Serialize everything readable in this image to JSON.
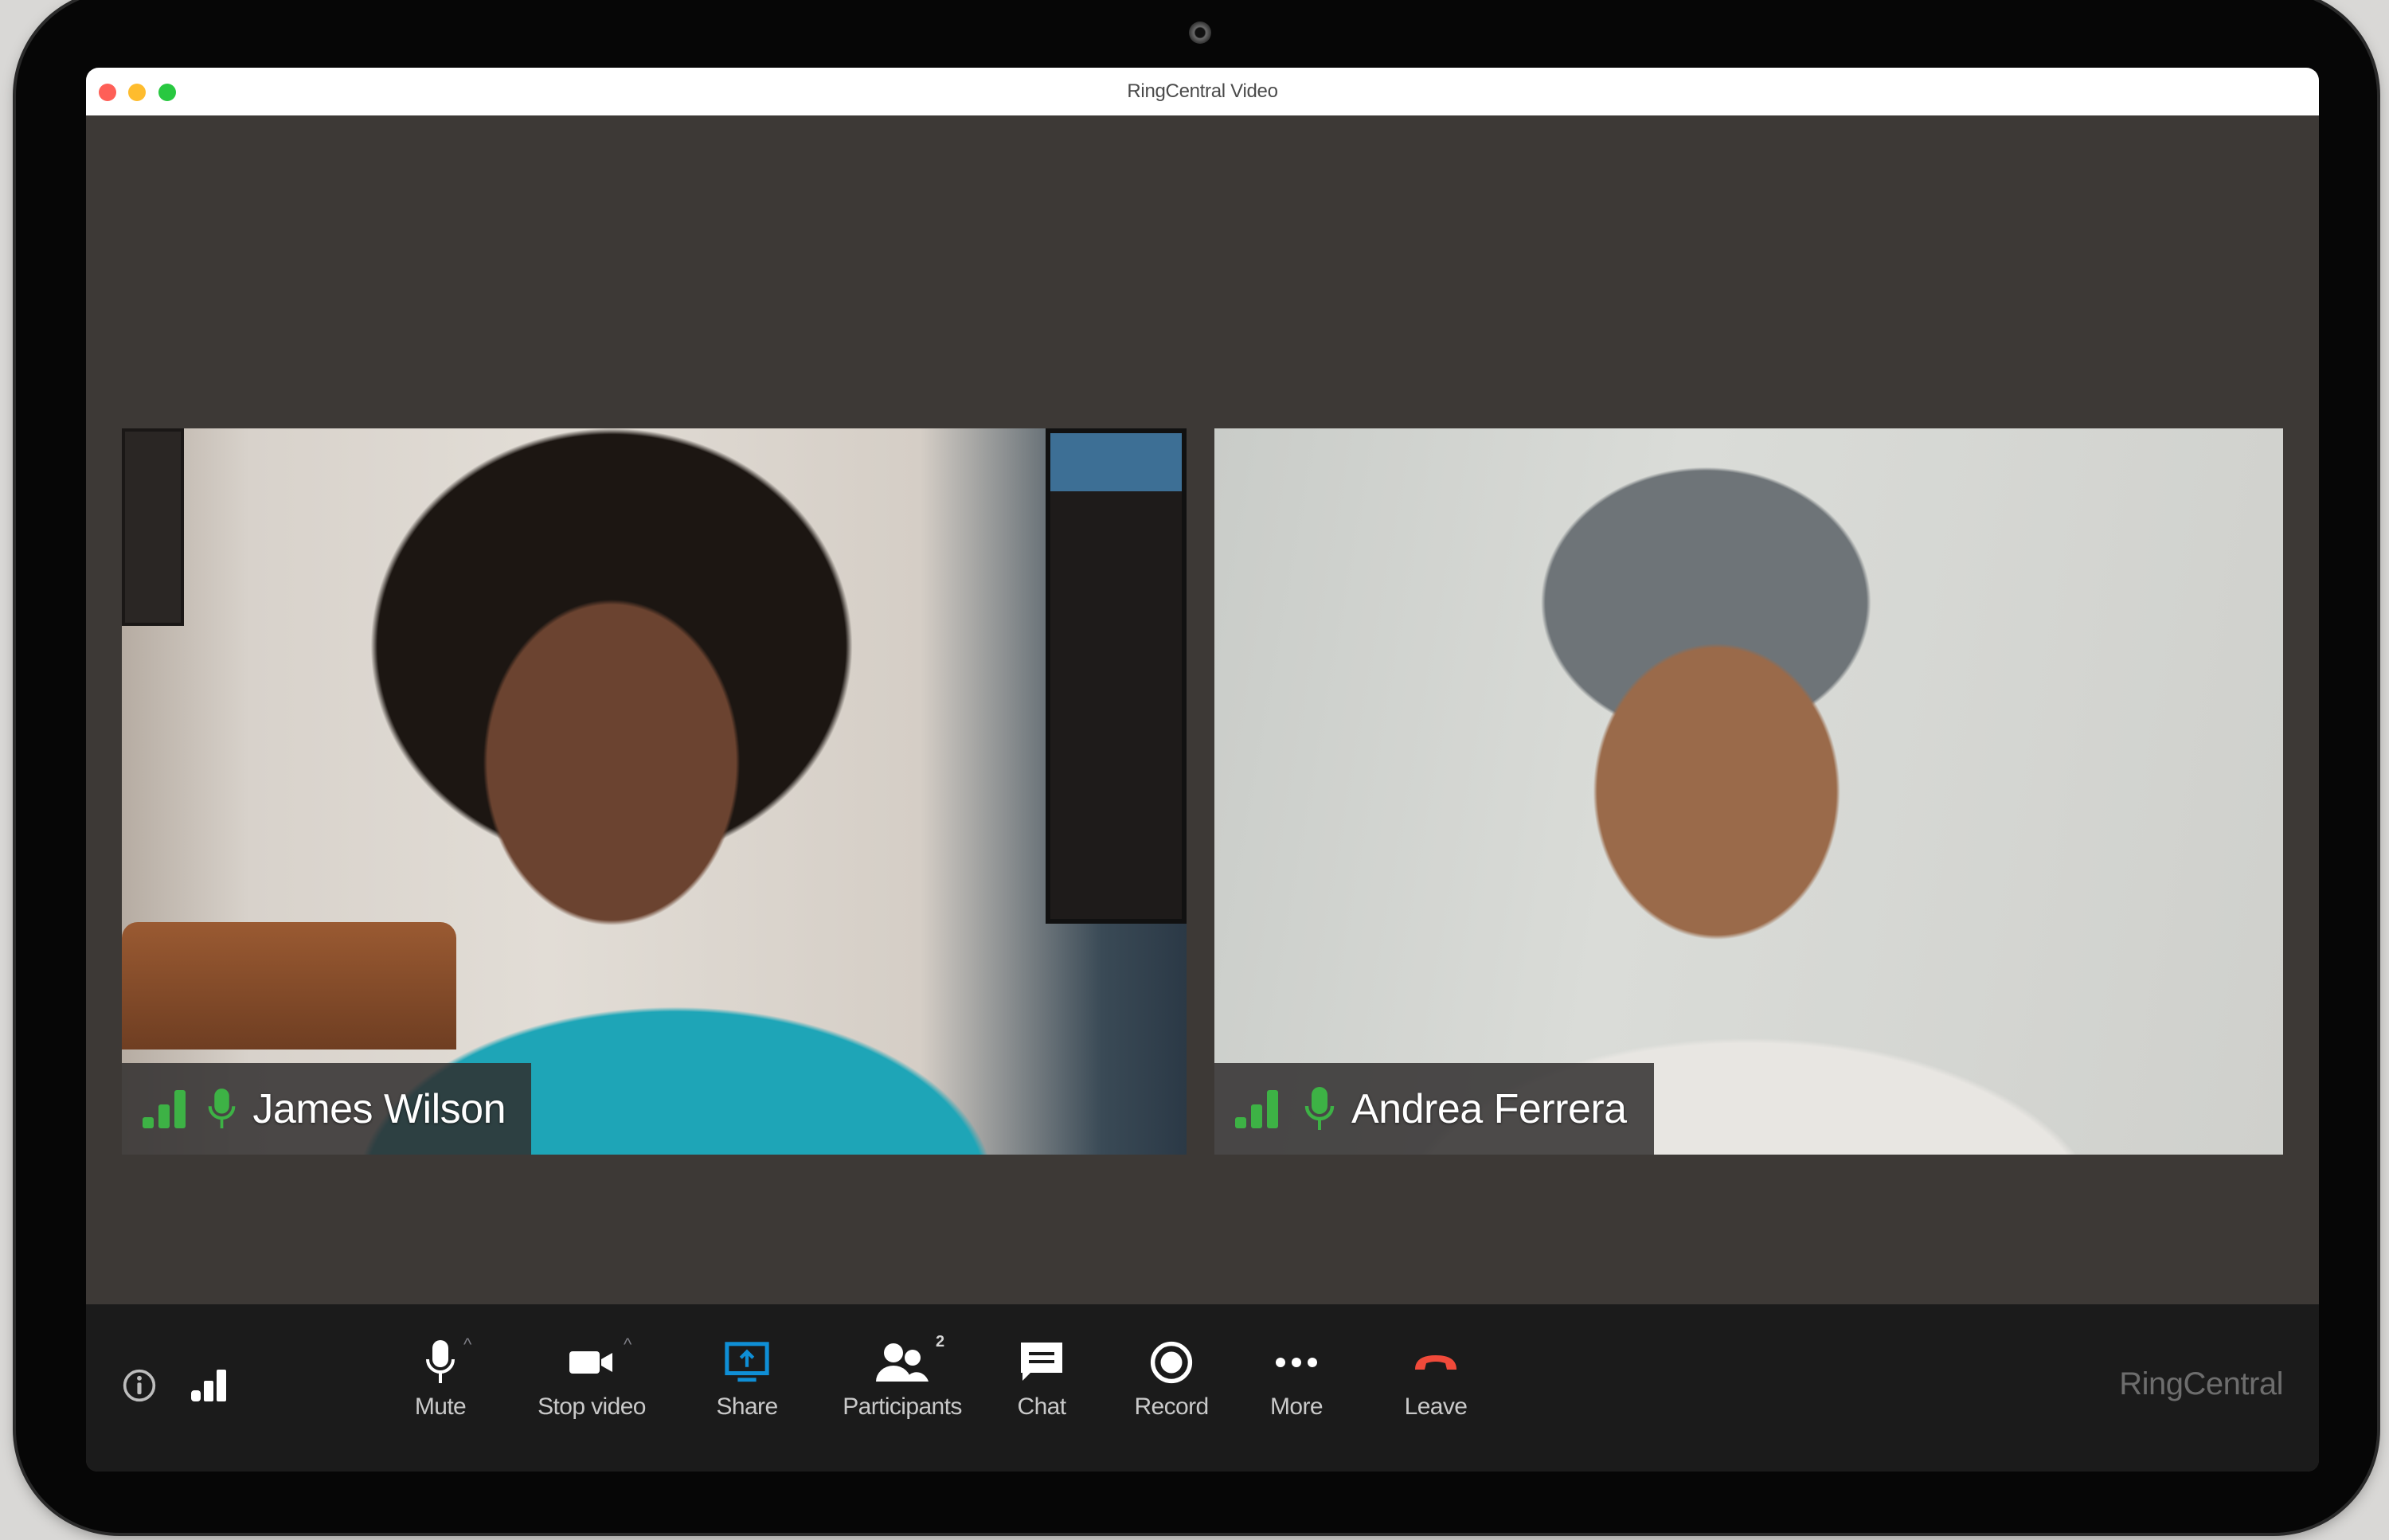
{
  "window": {
    "title": "RingCentral Video",
    "controls": [
      "close",
      "minimize",
      "maximize"
    ]
  },
  "participants": [
    {
      "name": "James Wilson",
      "mic_status": "unmuted",
      "signal_strength": "3 of 3 bars",
      "signal_color": "#3db245"
    },
    {
      "name": "Andrea Ferrera",
      "mic_status": "unmuted",
      "signal_strength": "3 of 3 bars",
      "signal_color": "#3db245"
    }
  ],
  "toolbar": {
    "left_icons": [
      {
        "name": "info-icon"
      },
      {
        "name": "network-signal-icon"
      }
    ],
    "buttons": [
      {
        "id": "mute",
        "label": "Mute",
        "icon": "microphone-icon",
        "has_caret": true
      },
      {
        "id": "stop-video",
        "label": "Stop video",
        "icon": "video-camera-icon",
        "has_caret": true
      },
      {
        "id": "share",
        "label": "Share",
        "icon": "share-screen-icon",
        "active": true,
        "icon_color": "#0f8fd6"
      },
      {
        "id": "participants",
        "label": "Participants",
        "icon": "participants-icon",
        "count": "2"
      },
      {
        "id": "chat",
        "label": "Chat",
        "icon": "chat-icon"
      },
      {
        "id": "record",
        "label": "Record",
        "icon": "record-icon"
      },
      {
        "id": "more",
        "label": "More",
        "icon": "more-dots-icon"
      },
      {
        "id": "leave",
        "label": "Leave",
        "icon": "hang-up-icon",
        "icon_color": "#f04a3a"
      }
    ],
    "brand": "RingCentral"
  },
  "colors": {
    "stage_bg": "#3d3936",
    "toolbar_bg": "#1b1b1b",
    "accent_blue": "#0f8fd6",
    "leave_red": "#f04a3a",
    "active_green": "#3db245"
  }
}
